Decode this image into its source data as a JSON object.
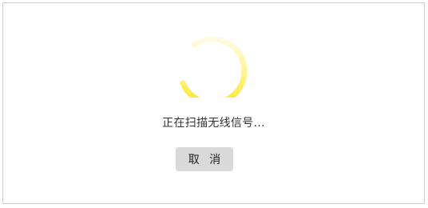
{
  "scan": {
    "status_text": "正在扫描无线信号...",
    "cancel_label": "取 消"
  },
  "colors": {
    "spinner_head": "#ffe52e",
    "spinner_tail": "#fffbe0",
    "button_bg": "#d9d9d9",
    "dialog_border": "#cfcfcf"
  },
  "icons": {
    "spinner": "loading-spinner-icon"
  }
}
